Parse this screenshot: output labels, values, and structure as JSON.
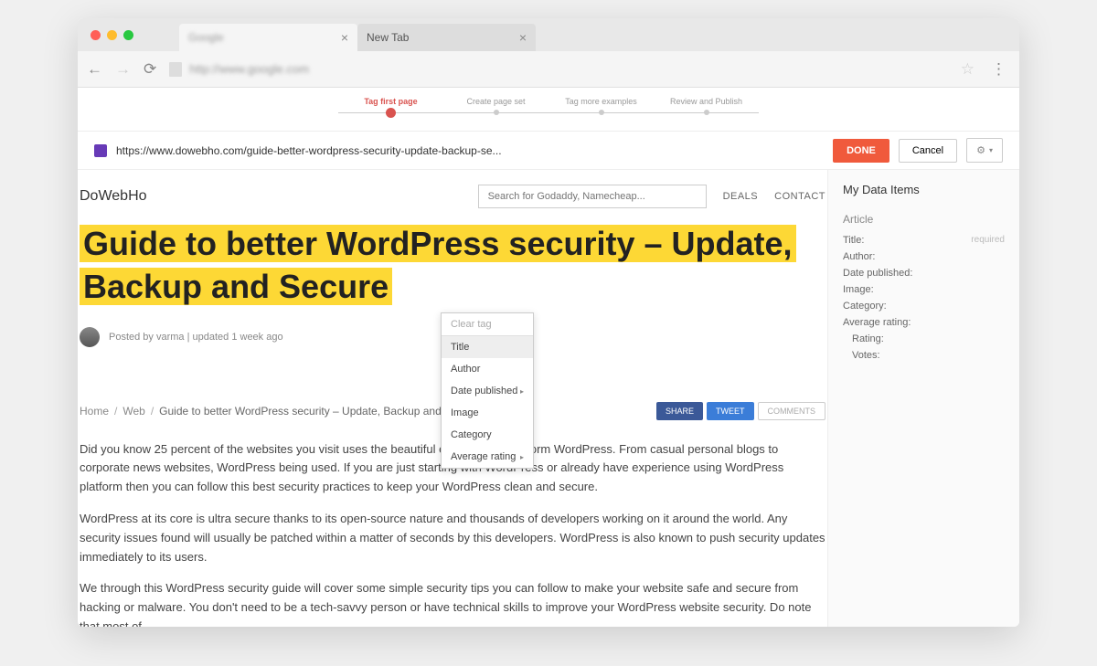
{
  "browser": {
    "tabs": [
      {
        "title": "Google",
        "blurred": true
      },
      {
        "title": "New Tab",
        "blurred": false
      }
    ],
    "url_blurred": "http://www.google.com"
  },
  "stepper": {
    "steps": [
      "Tag first page",
      "Create page set",
      "Tag more examples",
      "Review and Publish"
    ],
    "active_index": 0
  },
  "action_bar": {
    "url": "https://www.dowebho.com/guide-better-wordpress-security-update-backup-se...",
    "done": "DONE",
    "cancel": "Cancel"
  },
  "site": {
    "logo": "DoWebHo",
    "search_placeholder": "Search for Godaddy, Namecheap...",
    "nav": {
      "deals": "DEALS",
      "contact": "CONTACT"
    }
  },
  "article": {
    "title": "Guide to better WordPress security – Update, Backup and Secure",
    "meta": "Posted by varma | updated 1 week ago",
    "breadcrumb": {
      "home": "Home",
      "web": "Web",
      "current": "Guide to better WordPress security – Update, Backup and Secure"
    },
    "share": {
      "share": "SHARE",
      "tweet": "TWEET",
      "comments": "COMMENTS"
    },
    "paragraphs": [
      "Did you know 25 percent of the websites you visit uses the beautiful open source platform WordPress. From casual personal blogs to corporate news websites, WordPress being used. If you are just starting with WordPress or already have experience using WordPress platform then you can follow this best security practices to keep your WordPress clean and secure.",
      "WordPress at its core is ultra secure thanks to its open-source nature and thousands of developers working on it around the world. Any security issues found will usually be patched within a matter of seconds by this developers. WordPress is also known to push security updates immediately to its users.",
      "We through this WordPress security guide will cover some simple security tips you can follow to make your website safe and secure from hacking or malware. You don't need to be a tech-savvy person or have technical skills to improve your WordPress website security. Do note that most of"
    ]
  },
  "ctx_menu": {
    "clear": "Clear tag",
    "items": [
      "Title",
      "Author",
      "Date published",
      "Image",
      "Category",
      "Average rating"
    ],
    "has_submenu": {
      "Date published": true,
      "Average rating": true
    }
  },
  "sidebar": {
    "heading": "My Data Items",
    "group": "Article",
    "fields": [
      {
        "label": "Title:",
        "required": true
      },
      {
        "label": "Author:"
      },
      {
        "label": "Date published:"
      },
      {
        "label": "Image:"
      },
      {
        "label": "Category:"
      },
      {
        "label": "Average rating:"
      }
    ],
    "subfields": [
      "Rating:",
      "Votes:"
    ],
    "required_text": "required"
  }
}
